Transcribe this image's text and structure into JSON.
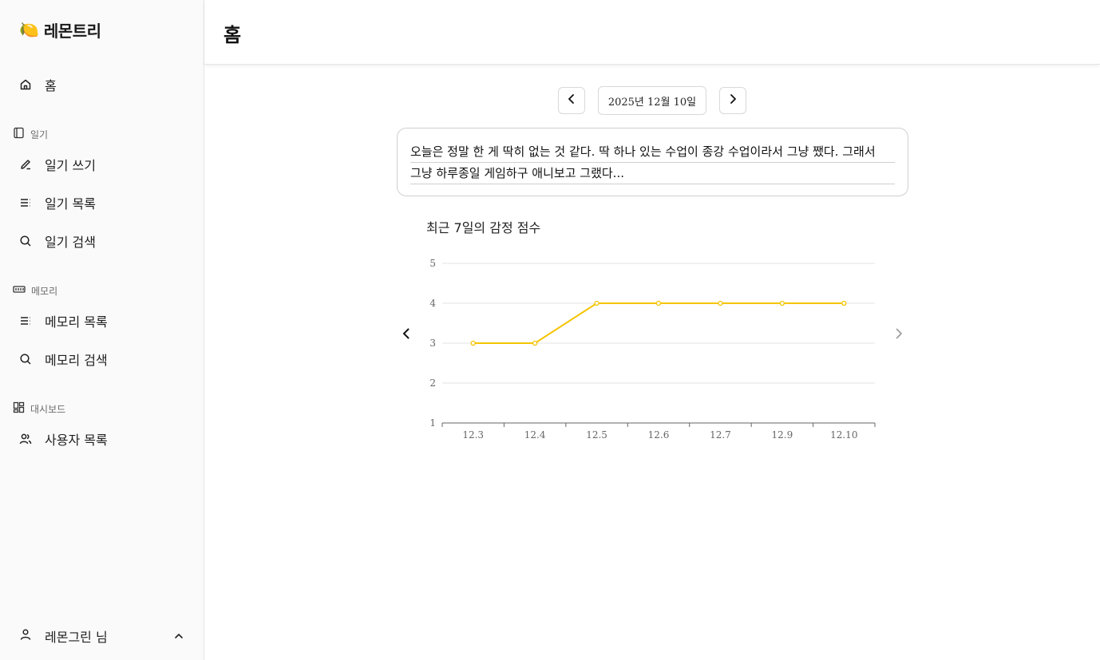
{
  "app": {
    "name": "레몬트리",
    "logo_icon": "lemon-icon"
  },
  "sidebar": {
    "home": {
      "label": "홈",
      "icon": "home-icon"
    },
    "sections": [
      {
        "title": "일기",
        "icon": "notebook-icon",
        "items": [
          {
            "label": "일기 쓰기",
            "icon": "pencil-icon"
          },
          {
            "label": "일기 목록",
            "icon": "list-icon"
          },
          {
            "label": "일기 검색",
            "icon": "search-icon"
          }
        ]
      },
      {
        "title": "메모리",
        "icon": "memory-icon",
        "items": [
          {
            "label": "메모리 목록",
            "icon": "list-icon"
          },
          {
            "label": "메모리 검색",
            "icon": "search-icon"
          }
        ]
      },
      {
        "title": "대시보드",
        "icon": "dashboard-icon",
        "items": [
          {
            "label": "사용자 목록",
            "icon": "users-icon"
          }
        ]
      }
    ],
    "user": {
      "label": "레몬그린 님",
      "icon": "user-icon"
    }
  },
  "header": {
    "title": "홈"
  },
  "date_nav": {
    "date": "2025년 12월 10일"
  },
  "diary": {
    "lines": [
      "오늘은 정말 한 게 딱히 없는 것 같다. 딱 하나 있는 수업이 종강 수업이라서 그냥 쨌다. 그래서",
      "그냥 하루종일 게임하구 애니보고 그랬다..."
    ]
  },
  "chart_title": "최근 7일의 감정 점수",
  "chart_data": {
    "type": "line",
    "title": "최근 7일의 감정 점수",
    "categories": [
      "12.3",
      "12.4",
      "12.5",
      "12.6",
      "12.7",
      "12.9",
      "12.10"
    ],
    "values": [
      3,
      3,
      4,
      4,
      4,
      4,
      4
    ],
    "ylim": [
      1,
      5
    ],
    "yticks": [
      1,
      2,
      3,
      4,
      5
    ],
    "grid": true,
    "line_color": "#f5c400"
  }
}
